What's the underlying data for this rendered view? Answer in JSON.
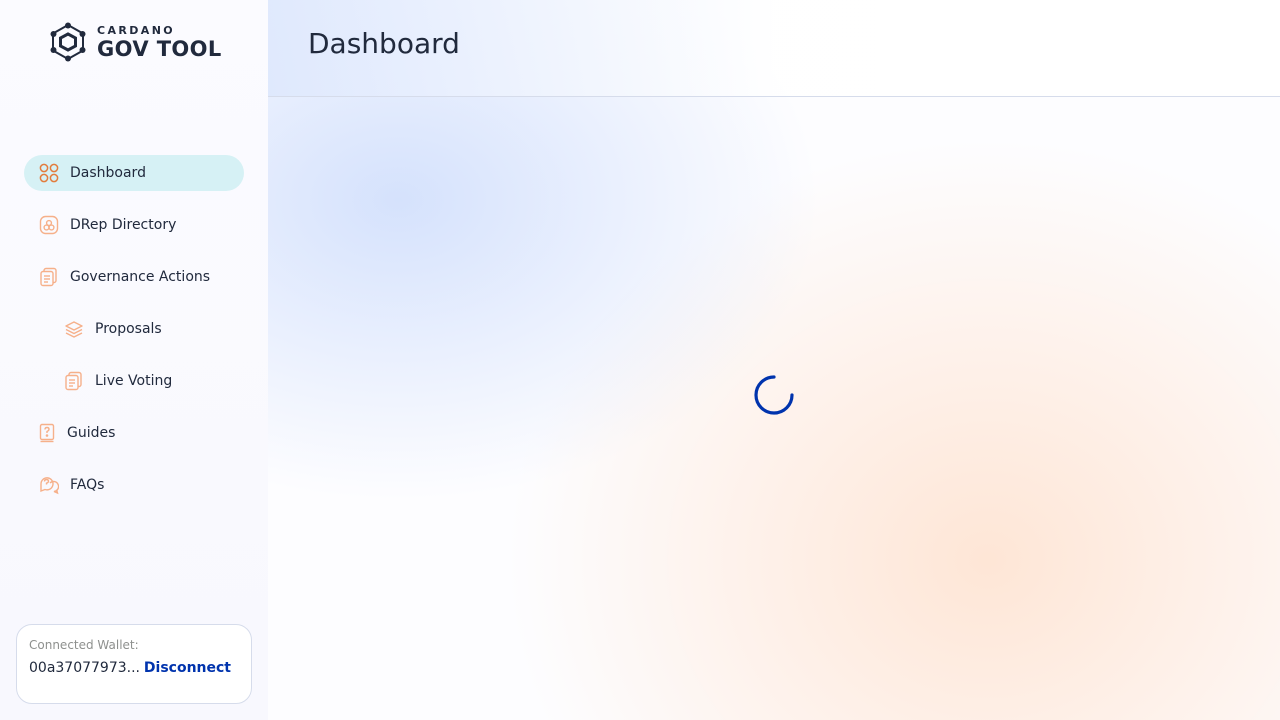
{
  "logo": {
    "small_text": "CARDANO",
    "big_text": "GOV TOOL"
  },
  "nav": {
    "items": [
      {
        "label": "Dashboard",
        "icon": "dashboard-icon",
        "active": true
      },
      {
        "label": "DRep Directory",
        "icon": "drep-directory-icon"
      },
      {
        "label": "Governance Actions",
        "icon": "governance-actions-icon"
      },
      {
        "label": "Proposals",
        "icon": "proposals-icon"
      },
      {
        "label": "Live Voting",
        "icon": "live-voting-icon"
      },
      {
        "label": "Guides",
        "icon": "guides-icon"
      },
      {
        "label": "FAQs",
        "icon": "faqs-icon"
      }
    ]
  },
  "wallet": {
    "label": "Connected Wallet:",
    "address": "00a37077973...",
    "disconnect_label": "Disconnect"
  },
  "header": {
    "title": "Dashboard"
  },
  "colors": {
    "accent": "#0033AD",
    "icon_orange": "#F6B08A",
    "active_bg": "#D6F1F5",
    "text": "#212A3D"
  }
}
